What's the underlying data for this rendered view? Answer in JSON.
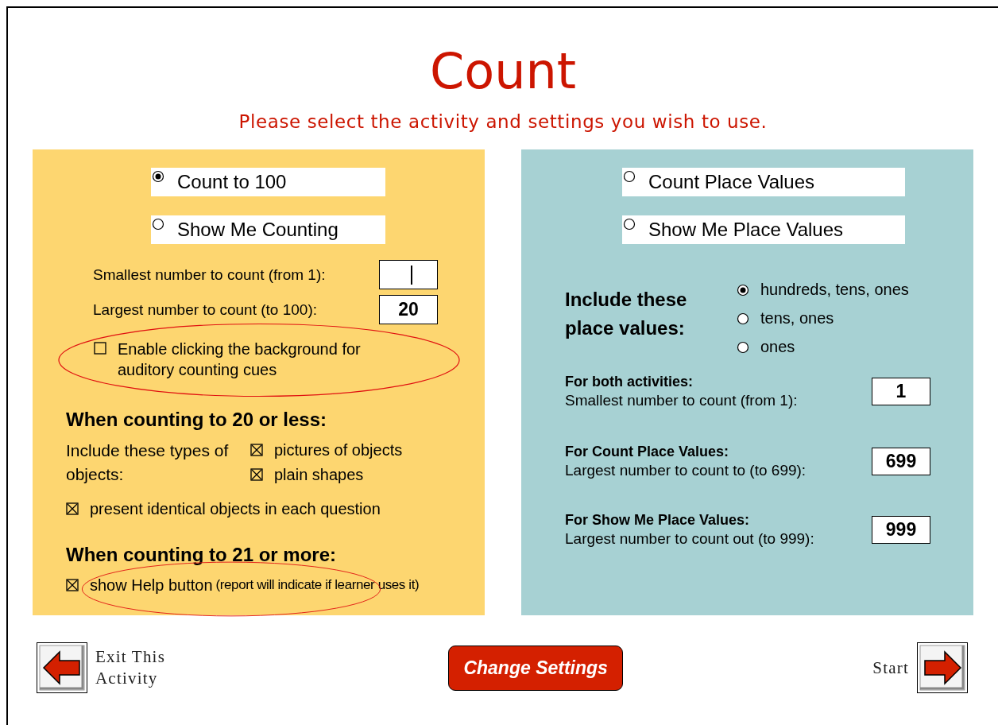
{
  "title": "Count",
  "subtitle": "Please select the activity and settings you wish to use.",
  "left_panel": {
    "activities": [
      {
        "label": "Count to 100",
        "selected": true
      },
      {
        "label": "Show Me Counting",
        "selected": false
      }
    ],
    "fields": [
      {
        "label": "Smallest number to count (from 1):",
        "focused": true
      },
      {
        "label": "Largest number to count (to 100):",
        "value": "20",
        "focused": false
      }
    ],
    "background_option": {
      "label": "Enable clicking the background for auditory counting cues",
      "checked": false,
      "highlighted": true
    },
    "small_counts": {
      "heading": "When counting to 20 or less:",
      "types_label": "Include these types of objects:",
      "types": [
        {
          "label": "pictures of objects",
          "checked": true
        },
        {
          "label": "plain shapes",
          "checked": true
        }
      ],
      "identical": {
        "label": "present identical objects in each question",
        "checked": true
      }
    },
    "large_counts": {
      "heading": "When counting to 21 or more:",
      "help": {
        "label": "show Help button",
        "note": "(report will indicate if learner uses it)",
        "checked": true,
        "highlighted": true
      }
    }
  },
  "right_panel": {
    "activities": [
      {
        "label": "Count Place Values",
        "selected": false
      },
      {
        "label": "Show Me Place Values",
        "selected": false
      }
    ],
    "place_values": {
      "heading": "Include these place values:",
      "options": [
        {
          "label": "hundreds, tens, ones",
          "selected": true
        },
        {
          "label": "tens, ones",
          "selected": false
        },
        {
          "label": "ones",
          "selected": false
        }
      ]
    },
    "fields": [
      {
        "heading": "For both activities:",
        "label": "Smallest number to count (from 1):",
        "value": "1"
      },
      {
        "heading": "For Count Place Values:",
        "label": "Largest number to count to (to 699):",
        "value": "699"
      },
      {
        "heading": "For Show Me Place Values:",
        "label": "Largest number to count out (to 999):",
        "value": "999"
      }
    ]
  },
  "footer": {
    "exit": {
      "label": "Exit This Activity"
    },
    "change_settings": "Change Settings",
    "start": {
      "label": "Start"
    }
  }
}
